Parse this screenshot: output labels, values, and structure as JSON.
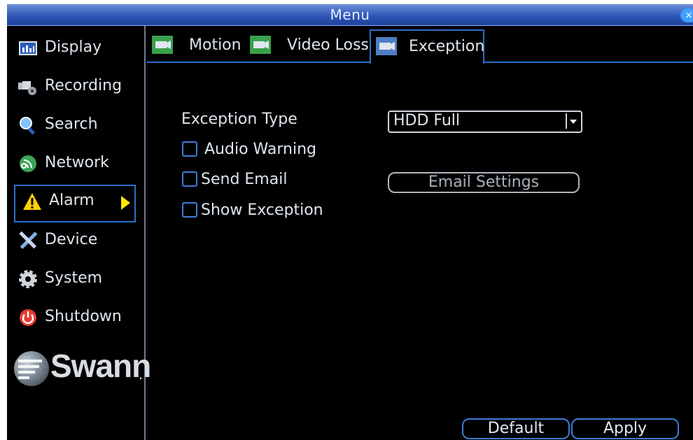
{
  "window": {
    "title": "Menu",
    "close_glyph": "×"
  },
  "sidebar": {
    "items": [
      {
        "label": "Display",
        "icon": "display-icon"
      },
      {
        "label": "Recording",
        "icon": "recording-icon"
      },
      {
        "label": "Search",
        "icon": "search-icon"
      },
      {
        "label": "Network",
        "icon": "network-icon"
      },
      {
        "label": "Alarm",
        "icon": "alarm-warning-icon",
        "active": true
      },
      {
        "label": "Device",
        "icon": "device-tools-icon"
      },
      {
        "label": "System",
        "icon": "gear-icon"
      },
      {
        "label": "Shutdown",
        "icon": "power-icon"
      }
    ],
    "brand": "Swann",
    "brand_suffix": "."
  },
  "tabs": [
    {
      "label": "Motion",
      "icon": "camera-icon"
    },
    {
      "label": "Video Loss",
      "icon": "camera-icon"
    },
    {
      "label": "Exception",
      "icon": "camera-icon",
      "active": true
    }
  ],
  "form": {
    "exception_type_label": "Exception Type",
    "exception_type_value": "HDD Full",
    "audio_warning_label": "Audio Warning",
    "audio_warning_checked": false,
    "send_email_label": "Send Email",
    "send_email_checked": false,
    "email_settings_label": "Email Settings",
    "show_exception_label": "Show Exception",
    "show_exception_checked": false
  },
  "footer": {
    "default_label": "Default",
    "apply_label": "Apply"
  },
  "colors": {
    "titlebar": "#2f58b8",
    "accent": "#2c6fc9",
    "background": "#000000",
    "alarm_arrow": "#ffe600"
  }
}
